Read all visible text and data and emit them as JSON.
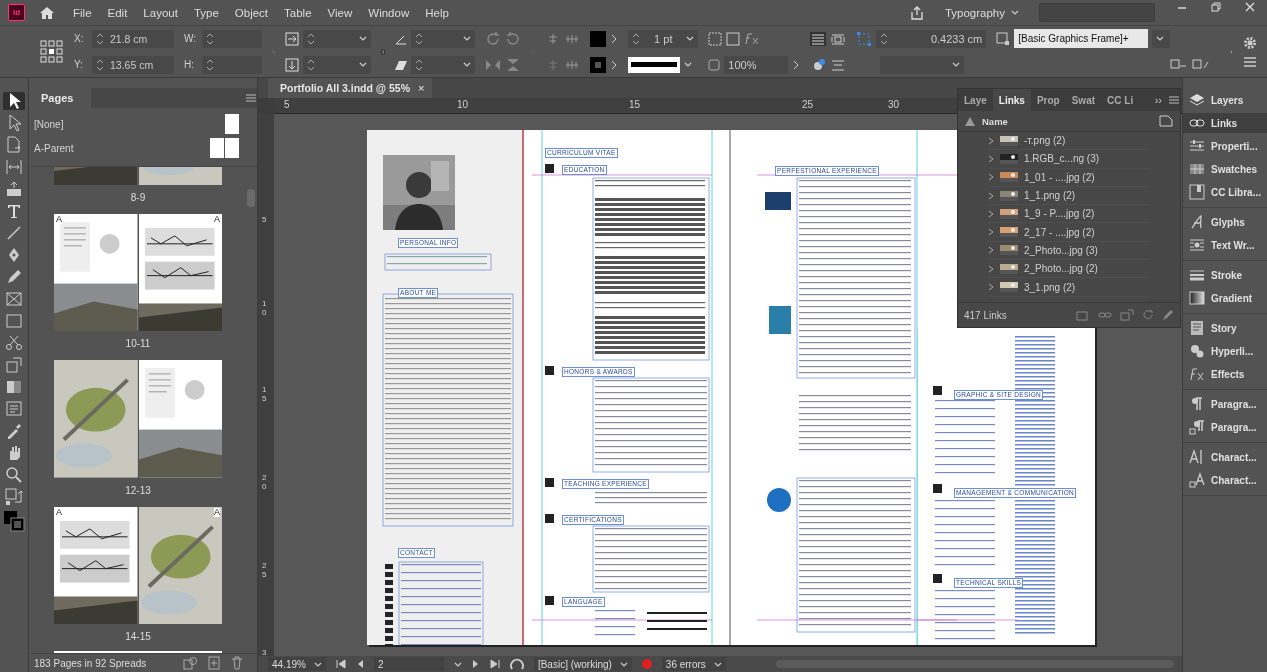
{
  "app": {
    "icon_label": "Id"
  },
  "menu": [
    "File",
    "Edit",
    "Layout",
    "Type",
    "Object",
    "Table",
    "View",
    "Window",
    "Help"
  ],
  "workspace": {
    "label": "Typography"
  },
  "control_bar": {
    "x_label": "X:",
    "x": "21.8 cm",
    "y_label": "Y:",
    "y": "13.65 cm",
    "w_label": "W:",
    "h_label": "H:",
    "stroke_weight": "1 pt",
    "opacity": "100%",
    "offset": "0.4233 cm",
    "object_style": "[Basic Graphics Frame]+"
  },
  "toolbox": {
    "tools": [
      {
        "selected": true
      },
      {
        "selected": false
      },
      {
        "selected": false
      },
      {
        "selected": false
      },
      {
        "selected": false
      },
      {
        "selected": false
      },
      {
        "selected": false
      },
      {
        "selected": false
      },
      {
        "selected": false
      },
      {
        "selected": false
      },
      {
        "selected": false
      },
      {
        "selected": false
      },
      {
        "selected": false
      },
      {
        "selected": false
      },
      {
        "selected": false
      },
      {
        "selected": false
      },
      {
        "selected": false
      },
      {
        "selected": false
      },
      {
        "selected": false
      }
    ]
  },
  "pages_panel": {
    "tab": "Pages",
    "parents": [
      {
        "label": "[None]",
        "kind": "single"
      },
      {
        "label": "A-Parent",
        "kind": "spread"
      }
    ],
    "spreads": [
      {
        "label": "8-9",
        "partial": true
      },
      {
        "label": "10-11",
        "marks": [
          "A",
          "A"
        ],
        "partial": false
      },
      {
        "label": "12-13",
        "partial": false
      },
      {
        "label": "14-15",
        "marks": [
          "A",
          "A"
        ],
        "partial": false
      }
    ],
    "footer": "183 Pages in 92 Spreads"
  },
  "document": {
    "tab": "Portfolio All 3.indd @ 55%",
    "close": "×",
    "ruler_h": [
      "5",
      "10",
      "15",
      "25",
      "30"
    ],
    "ruler_v": [
      "5",
      "10",
      "15",
      "20",
      "25",
      "3"
    ],
    "headings": [
      "PERSONAL INFO",
      "ABOUT ME",
      "CONTACT",
      "CURRICULUM VITAE",
      "EDUCATION",
      "HONORS & AWARDS",
      "TEACHING EXPERIENCE",
      "CERTIFICATIONS",
      "LANGUAGE",
      "PERFESTIONAL EXPERIENCE",
      "GRAPHIC & SITE DESIGN",
      "MANAGEMENT & COMMUNICATION",
      "TECHNICAL SKILLS"
    ]
  },
  "links_panel": {
    "tabs": [
      {
        "label": "Laye",
        "selected": false
      },
      {
        "label": "Links",
        "selected": true
      },
      {
        "label": "Prop",
        "selected": false
      },
      {
        "label": "Swat",
        "selected": false
      },
      {
        "label": "CC Li",
        "selected": false
      }
    ],
    "more": "››",
    "column": "Name",
    "rows": [
      {
        "name": "-т.png (2)"
      },
      {
        "name": "1.RGB_c...ng (3)"
      },
      {
        "name": "1_01 - ....jpg (2)"
      },
      {
        "name": "1_1.png (2)"
      },
      {
        "name": "1_9 - P....jpg (2)"
      },
      {
        "name": "2_17 - ....jpg (2)"
      },
      {
        "name": "2_Photo...jpg (3)"
      },
      {
        "name": "2_Photo...jpg (2)"
      },
      {
        "name": "3_1.png (2)"
      }
    ],
    "count": "417 Links"
  },
  "dock": {
    "groups": [
      [
        {
          "label": "Layers",
          "selected": false
        },
        {
          "label": "Links",
          "selected": true
        },
        {
          "label": "Properti...",
          "selected": false
        },
        {
          "label": "Swatches",
          "selected": false
        },
        {
          "label": "CC Libra...",
          "selected": false
        }
      ],
      [
        {
          "label": "Glyphs",
          "selected": false
        },
        {
          "label": "Text Wr...",
          "selected": false
        }
      ],
      [
        {
          "label": "Stroke",
          "selected": false
        },
        {
          "label": "Gradient",
          "selected": false
        }
      ],
      [
        {
          "label": "Story",
          "selected": false
        },
        {
          "label": "Hyperli...",
          "selected": false
        },
        {
          "label": "Effects",
          "selected": false
        }
      ],
      [
        {
          "label": "Paragra...",
          "selected": false
        },
        {
          "label": "Paragra...",
          "selected": false
        }
      ],
      [
        {
          "label": "Charact...",
          "selected": false
        },
        {
          "label": "Charact...",
          "selected": false
        }
      ]
    ]
  },
  "status_bar": {
    "zoom": "44.19%",
    "page": "2",
    "preflight_profile": "[Basic] (working)",
    "errors": "36 errors"
  }
}
